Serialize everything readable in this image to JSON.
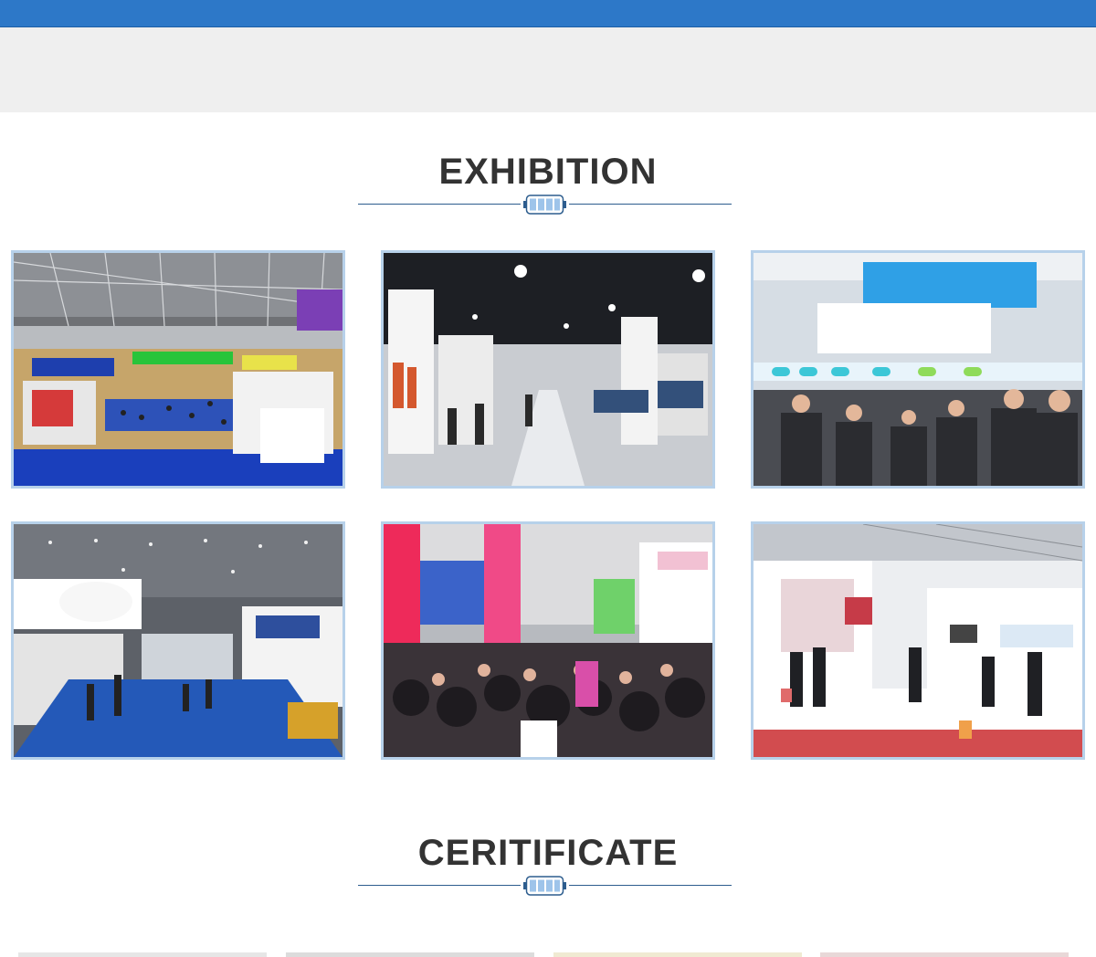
{
  "header": {
    "bar_color": "#2d78c8",
    "band_color": "#efefef"
  },
  "exhibition": {
    "title": "EXHIBITION",
    "divider_icon": "battery-bars-icon",
    "photos": [
      {
        "name": "exhibition-hall-overview"
      },
      {
        "name": "garment-booth-aisle"
      },
      {
        "name": "crowded-booth-visitors"
      },
      {
        "name": "blue-carpet-hall"
      },
      {
        "name": "pink-crowded-hall"
      },
      {
        "name": "white-booth-meeting"
      }
    ]
  },
  "certificate": {
    "title": "CERITIFICATE",
    "divider_icon": "battery-bars-icon"
  },
  "colors": {
    "accent": "#2d78c8",
    "frame": "#b7d1ea",
    "title_text": "#333333",
    "divider_line": "#2d5d8e"
  }
}
